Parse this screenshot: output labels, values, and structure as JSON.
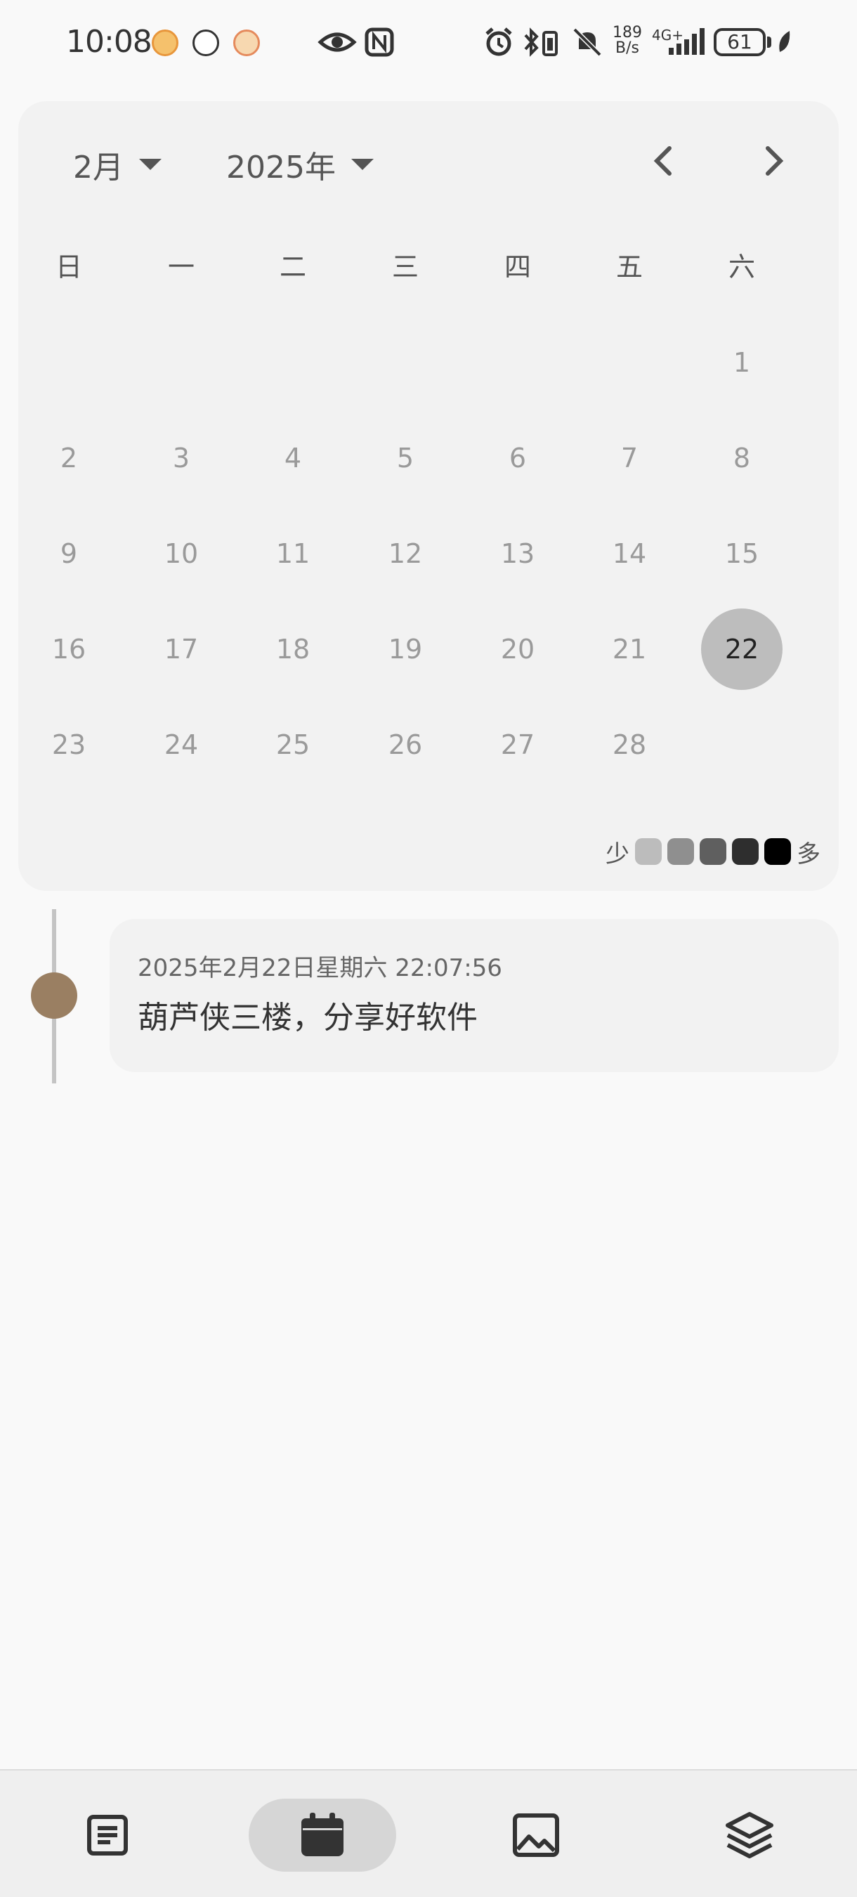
{
  "status_bar": {
    "time": "10:08",
    "net_speed_top": "189",
    "net_speed_bottom": "B/s",
    "net_type": "4G+",
    "battery": "61"
  },
  "calendar": {
    "month_label": "2月",
    "year_label": "2025年",
    "weekdays": [
      "日",
      "一",
      "二",
      "三",
      "四",
      "五",
      "六"
    ],
    "weeks": [
      [
        "",
        "",
        "",
        "",
        "",
        "",
        "1"
      ],
      [
        "2",
        "3",
        "4",
        "5",
        "6",
        "7",
        "8"
      ],
      [
        "9",
        "10",
        "11",
        "12",
        "13",
        "14",
        "15"
      ],
      [
        "16",
        "17",
        "18",
        "19",
        "20",
        "21",
        "22"
      ],
      [
        "23",
        "24",
        "25",
        "26",
        "27",
        "28",
        ""
      ]
    ],
    "selected_day": "22",
    "legend": {
      "less_label": "少",
      "more_label": "多",
      "colors": [
        "#bcbcbc",
        "#8f8f8f",
        "#5f5f5f",
        "#2e2e2e",
        "#000000"
      ]
    }
  },
  "entry": {
    "date": "2025年2月22日星期六 22:07:56",
    "text": "葫芦侠三楼，分享好软件",
    "dot_color": "#9a7f62"
  },
  "bottom_nav": {
    "items": [
      {
        "icon": "notes-icon",
        "active": false
      },
      {
        "icon": "calendar-icon",
        "active": true
      },
      {
        "icon": "image-icon",
        "active": false
      },
      {
        "icon": "layers-icon",
        "active": false
      }
    ]
  }
}
